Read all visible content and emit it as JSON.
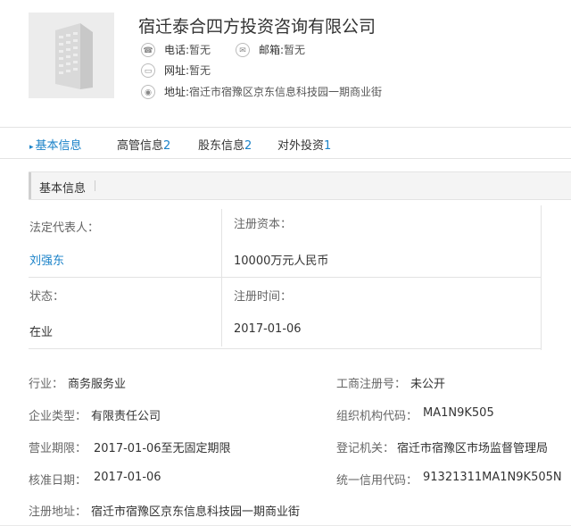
{
  "company": {
    "name": "宿迁泰合四方投资咨询有限公司",
    "phone_label": "电话:",
    "phone_value": "暂无",
    "email_label": "邮箱:",
    "email_value": "暂无",
    "website_label": "网址:",
    "website_value": "暂无",
    "address_label": "地址:",
    "address_value": "宿迁市宿豫区京东信息科技园一期商业街"
  },
  "tabs": [
    {
      "label": "基本信息",
      "count": ""
    },
    {
      "label": "高管信息",
      "count": "2"
    },
    {
      "label": "股东信息",
      "count": "2"
    },
    {
      "label": "对外投资",
      "count": "1"
    }
  ],
  "section": {
    "title": "基本信息"
  },
  "grid": {
    "legal_rep_label": "法定代表人：",
    "legal_rep_value": "刘强东",
    "capital_label": "注册资本：",
    "capital_value": "10000万元人民币",
    "status_label": "状态：",
    "status_value": "在业",
    "reg_time_label": "注册时间：",
    "reg_time_value": "2017-01-06"
  },
  "details": {
    "industry_label": "行业：",
    "industry_value": "商务服务业",
    "biz_reg_label": "工商注册号：",
    "biz_reg_value": "未公开",
    "type_label": "企业类型：",
    "type_value": "有限责任公司",
    "org_code_label": "组织机构代码：",
    "org_code_value": "MA1N9K505",
    "term_label": "营业期限：",
    "term_value": "2017-01-06至无固定期限",
    "authority_label": "登记机关：",
    "authority_value": "宿迁市宿豫区市场监督管理局",
    "approval_label": "核准日期：",
    "approval_value": "2017-01-06",
    "credit_label": "统一信用代码：",
    "credit_value": "91321311MA1N9K505N",
    "reg_addr_label": "注册地址：",
    "reg_addr_value": "宿迁市宿豫区京东信息科技园一期商业街"
  },
  "colors": {
    "accent": "#1a82c8",
    "border": "#e3e3e3",
    "section_bg": "#f4f4f4"
  },
  "icons": [
    "building-logo-icon",
    "phone-icon",
    "email-icon",
    "website-icon",
    "location-icon"
  ]
}
